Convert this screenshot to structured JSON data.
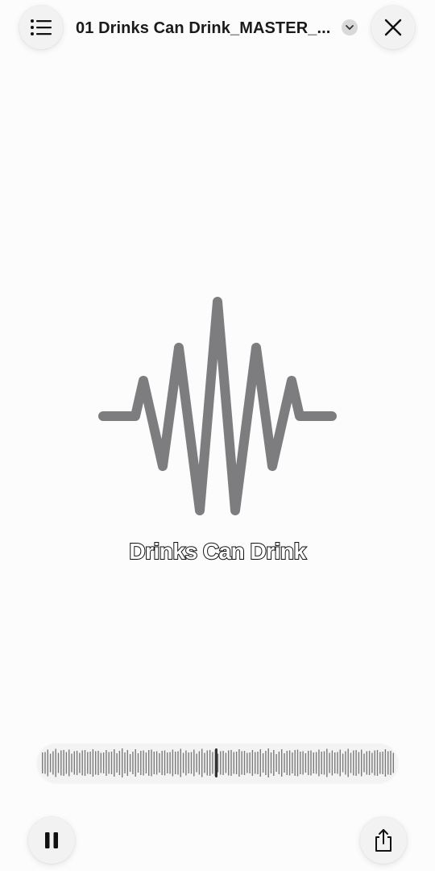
{
  "header": {
    "title": "01 Drinks Can Drink_MASTER_...",
    "menu_icon": "list-icon",
    "chevron_icon": "chevron-down-icon",
    "close_icon": "close-icon"
  },
  "artwork": {
    "icon": "waveform-icon",
    "caption": "Drinks Can Drink",
    "color": "#7d7d80"
  },
  "player": {
    "scrubber_icon": "audio-waveform-scrubber",
    "pause_icon": "pause-icon",
    "share_icon": "share-icon"
  }
}
